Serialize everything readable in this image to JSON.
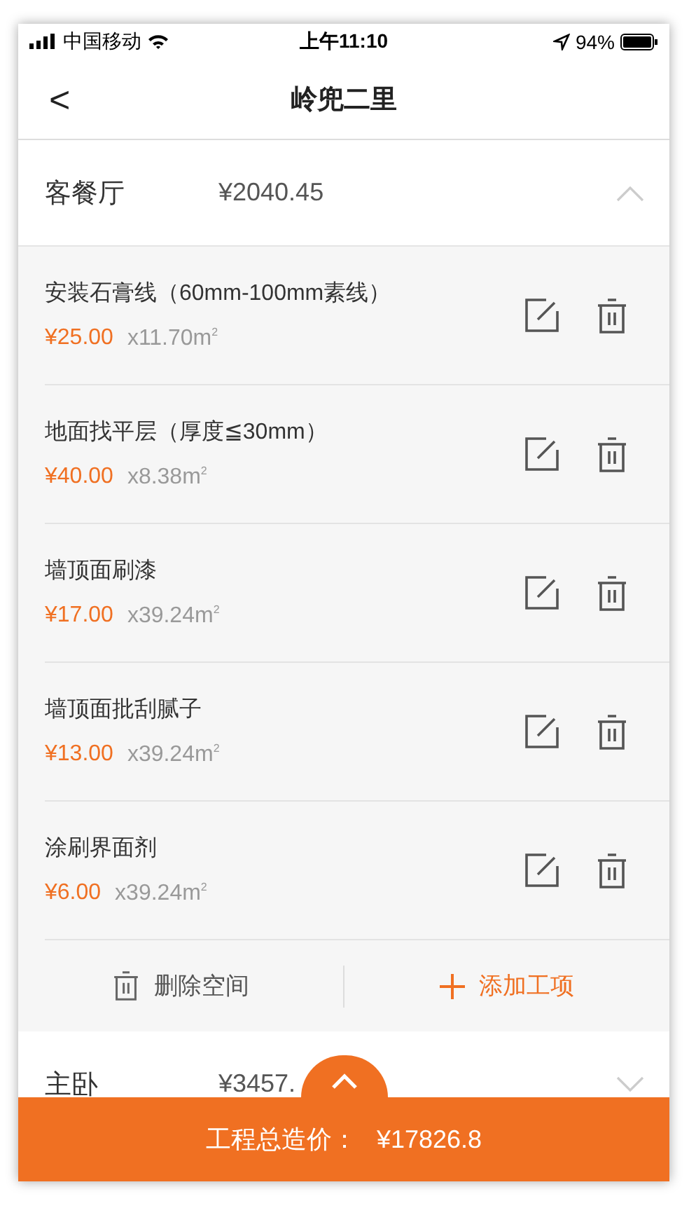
{
  "status_bar": {
    "carrier": "中国移动",
    "time": "上午11:10",
    "battery": "94%"
  },
  "nav": {
    "back": "<",
    "title": "岭兜二里"
  },
  "sections": [
    {
      "name": "客餐厅",
      "total": "¥2040.45",
      "expanded": true,
      "items": [
        {
          "name": "安装石膏线（60mm-100mm素线）",
          "price": "¥25.00",
          "quantity": "x11.70m$^{2}$"
        },
        {
          "name": "地面找平层（厚度≦30mm）",
          "price": "¥40.00",
          "quantity": "x8.38m$^{2}$"
        },
        {
          "name": "墙顶面刷漆",
          "price": "¥17.00",
          "quantity": "x39.24m$^{2}$"
        },
        {
          "name": "墙顶面批刮腻子",
          "price": "¥13.00",
          "quantity": "x39.24m$^{2}$"
        },
        {
          "name": "涂刷界面剂",
          "price": "¥6.00",
          "quantity": "x39.24m$^{2}$"
        }
      ],
      "actions": [
        {
          "kind": "delete",
          "label": "删除空间"
        },
        {
          "kind": "add",
          "label": "添加工项"
        }
      ]
    },
    {
      "name": "主卧",
      "total": "¥3457.",
      "expanded": false
    }
  ],
  "total_bar": {
    "label": "工程总造价：",
    "value": "¥17826.8"
  }
}
